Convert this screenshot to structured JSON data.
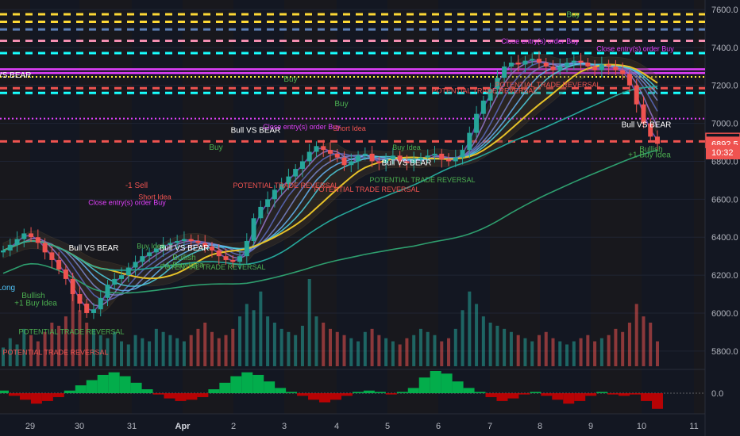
{
  "chart_data": [
    {
      "type": "candlestick",
      "title": "",
      "price_axis": {
        "ticks": [
          "7600.0",
          "7400.0",
          "7200.0",
          "7000.0",
          "6800.0",
          "6600.0",
          "6400.0",
          "6200.0",
          "6000.0",
          "5800.0"
        ],
        "ylim": [
          5720,
          7650
        ]
      },
      "time_axis": {
        "ticks": [
          "29",
          "30",
          "31",
          "Apr",
          "2",
          "3",
          "4",
          "5",
          "6",
          "7",
          "8",
          "9",
          "10",
          "11"
        ]
      },
      "price_tags": [
        {
          "text": "6910.0",
          "value": 6910.0,
          "color": "#ef5350",
          "outline": true
        },
        {
          "text": "6892.5",
          "value": 6892.5,
          "color": "#ef5350"
        },
        {
          "text": "10:32",
          "value": 6848.0,
          "color": "#ef5350"
        }
      ],
      "horizontal_levels": [
        {
          "value": 7575,
          "color": "#fdd835",
          "style": "dashed"
        },
        {
          "value": 7535,
          "color": "#fdd835",
          "style": "dashed"
        },
        {
          "value": 7495,
          "color": "#5b7fb5",
          "style": "dashed"
        },
        {
          "value": 7435,
          "color": "#f48fb1",
          "style": "dashed"
        },
        {
          "value": 7370,
          "color": "#18ffff",
          "style": "dashed"
        },
        {
          "value": 7285,
          "color": "#e040fb",
          "style": "solid"
        },
        {
          "value": 7265,
          "color": "#e040fb",
          "style": "solid"
        },
        {
          "value": 7245,
          "color": "#ffeb3b",
          "style": "dotted"
        },
        {
          "value": 7185,
          "color": "#ef5350",
          "style": "dashed"
        },
        {
          "value": 7160,
          "color": "#18ffff",
          "style": "dashed"
        },
        {
          "value": 7025,
          "color": "#e040fb",
          "style": "dotted"
        },
        {
          "value": 6905,
          "color": "#ef5350",
          "style": "dashed"
        }
      ],
      "candles_close": [
        6330,
        6360,
        6390,
        6420,
        6400,
        6370,
        6320,
        6280,
        6230,
        6180,
        6100,
        6050,
        6000,
        6020,
        6080,
        6150,
        6180,
        6200,
        6240,
        6270,
        6300,
        6320,
        6340,
        6360,
        6370,
        6380,
        6390,
        6380,
        6370,
        6350,
        6330,
        6300,
        6280,
        6270,
        6300,
        6380,
        6500,
        6560,
        6600,
        6650,
        6680,
        6720,
        6760,
        6800,
        6850,
        6880,
        6860,
        6840,
        6820,
        6780,
        6800,
        6830,
        6840,
        6800,
        6790,
        6810,
        6830,
        6800,
        6790,
        6810,
        6820,
        6830,
        6840,
        6810,
        6800,
        6820,
        6860,
        6950,
        7050,
        7120,
        7180,
        7240,
        7300,
        7320,
        7310,
        7330,
        7340,
        7320,
        7300,
        7280,
        7300,
        7320,
        7330,
        7320,
        7300,
        7280,
        7310,
        7300,
        7280,
        7260,
        7200,
        7100,
        7000,
        6930,
        6892.5
      ],
      "volume": [
        30,
        45,
        35,
        60,
        50,
        40,
        55,
        70,
        65,
        80,
        120,
        90,
        70,
        60,
        50,
        45,
        55,
        40,
        35,
        50,
        45,
        40,
        60,
        55,
        50,
        45,
        40,
        50,
        60,
        70,
        55,
        45,
        50,
        60,
        80,
        100,
        90,
        120,
        80,
        70,
        60,
        55,
        50,
        65,
        140,
        80,
        70,
        60,
        55,
        50,
        45,
        40,
        55,
        60,
        50,
        45,
        40,
        35,
        45,
        50,
        60,
        55,
        50,
        40,
        45,
        60,
        90,
        120,
        100,
        80,
        70,
        65,
        60,
        55,
        50,
        45,
        40,
        50,
        55,
        45,
        40,
        35,
        40,
        45,
        50,
        40,
        45,
        50,
        60,
        55,
        70,
        100,
        80,
        70,
        40
      ],
      "annotations": [
        "Bull VS BEAR",
        "Buy",
        "Sell",
        "-1 Sell",
        "+1 Buy Idea",
        "Bullish",
        "Long",
        "POTENTIAL TRADE REVERSAL",
        "Close entry(s) order Buy",
        "Short Idea",
        "Buy Idea"
      ],
      "oscillator": {
        "ticks": [
          "0.0"
        ],
        "values": [
          0.2,
          -0.2,
          -0.5,
          -0.8,
          -0.6,
          -0.3,
          0.2,
          0.6,
          1.0,
          1.4,
          1.6,
          1.3,
          0.8,
          0.3,
          -0.1,
          -0.4,
          -0.6,
          -0.5,
          -0.3,
          0.3,
          0.8,
          1.3,
          1.6,
          1.4,
          0.9,
          0.4,
          0.1,
          -0.2,
          -0.5,
          -0.7,
          -0.5,
          -0.2,
          0.1,
          0.2,
          0.1,
          -0.1,
          0.1,
          0.4,
          1.2,
          1.7,
          1.5,
          0.9,
          0.4,
          0.1,
          -0.3,
          -0.6,
          -0.4,
          -0.1,
          0.1,
          -0.2,
          -0.5,
          -0.8,
          -0.6,
          -0.2,
          0.1,
          -0.1,
          -0.2,
          -0.1,
          -0.6,
          -1.2
        ]
      }
    }
  ]
}
